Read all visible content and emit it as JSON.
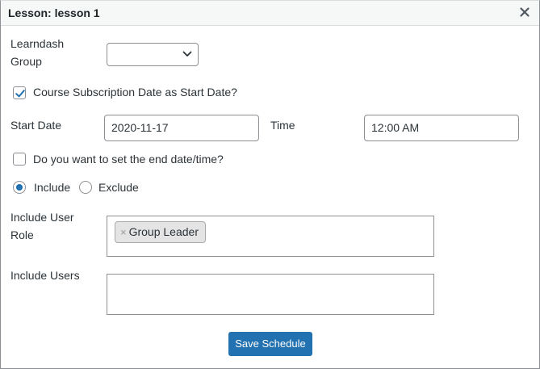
{
  "dialog": {
    "title": "Lesson: lesson 1",
    "close_icon": "close-icon"
  },
  "form": {
    "group_label_line1": "Learndash",
    "group_label_line2": "Group",
    "group_value": "",
    "subscription_checkbox_label": "Course Subscription Date as Start Date?",
    "subscription_checked": true,
    "start_date_label": "Start Date",
    "start_date_value": "2020-11-17",
    "time_label": "Time",
    "time_value": "12:00 AM",
    "end_date_checkbox_label": "Do you want to set the end date/time?",
    "end_date_checked": false,
    "include_label": "Include",
    "exclude_label": "Exclude",
    "include_selected": true,
    "include_role_label_line1": "Include User",
    "include_role_label_line2": "Role",
    "role_tags": [
      {
        "remove": "×",
        "label": "Group Leader"
      }
    ],
    "include_users_label": "Include Users",
    "save_button": "Save Schedule"
  },
  "colors": {
    "accent": "#2271b1",
    "text": "#2c3338",
    "border": "#8c8f94"
  }
}
